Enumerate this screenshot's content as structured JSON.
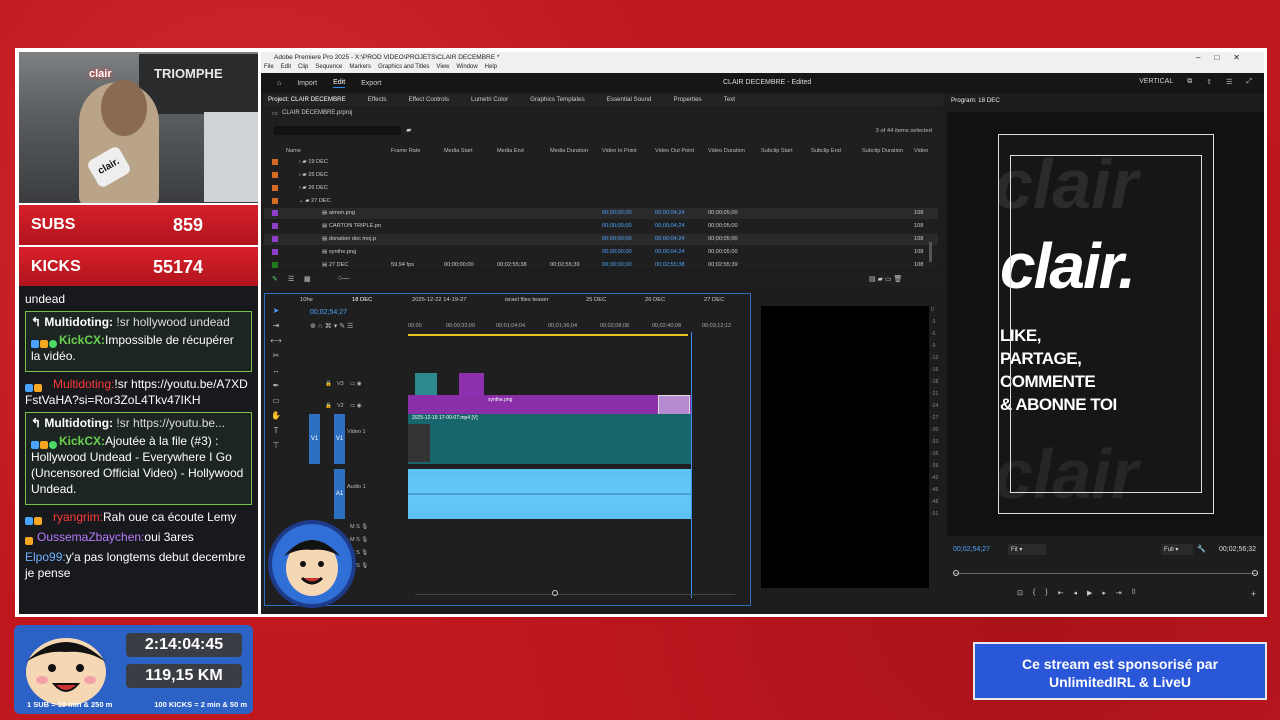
{
  "colors": {
    "brand_red": "#c11a22",
    "accent_blue": "#2d8ceb",
    "kick_green": "#6ad14f",
    "sponsor_blue": "#2a56d8"
  },
  "stats": {
    "subs_label": "SUBS",
    "subs_value": "859",
    "kicks_label": "KICKS",
    "kicks_value": "55174"
  },
  "webcam": {
    "neon_text": "clair",
    "poster_text": "TRIOMPHE",
    "mic_label": "clair."
  },
  "chat": {
    "top_text": "undead",
    "m1": {
      "user": "Multidoting:",
      "reply": "!sr hollywood undead",
      "user2": "KickCX:",
      "text": "Impossible de récupérer la vidéo."
    },
    "m2": {
      "user": "Multidoting:",
      "text": "!sr https://youtu.be/A7XDFstVaHA?si=Ror3ZoL4Tkv47IKH"
    },
    "m3": {
      "user": "Multidoting:",
      "reply": "!sr https://youtu.be...",
      "user2": "KickCX:",
      "text": "Ajoutée à la file (#3) : Hollywood Undead - Everywhere I Go (Uncensored Official Video) - Hollywood Undead."
    },
    "m4": {
      "user": "ryangrim:",
      "text": "Rah oue ca écoute Lemy"
    },
    "m5": {
      "user": "OussemaZbaychen:",
      "text": "oui 3ares"
    },
    "m6": {
      "user": "Elpo99:",
      "text": "y'a pas longtems debut decembre je pense"
    }
  },
  "premiere": {
    "app_title": "Adobe Premiere Pro 2025 - X:\\PROD VIDEO\\PROJETS\\CLAIR DECEMBRE *",
    "menu": [
      "File",
      "Edit",
      "Clip",
      "Sequence",
      "Markers",
      "Graphics and Titles",
      "View",
      "Window",
      "Help"
    ],
    "header_tabs": {
      "import": "Import",
      "edit": "Edit",
      "export": "Export"
    },
    "center_title": "CLAIR DECEMBRE - Edited",
    "vertical_label": "VERTICAL",
    "panels": [
      "Project: CLAIR DECEMBRE",
      "Effects",
      "Effect Controls",
      "Lumetri Color",
      "Graphics Templates",
      "Essential Sound",
      "Properties",
      "Text"
    ],
    "project": {
      "path": "CLAIR DECEMBRE.prproj",
      "count": "3 of 44 items selected",
      "columns": [
        "Name",
        "Frame Rate",
        "Media Start",
        "Media End",
        "Media Duration",
        "Video In Point",
        "Video Out Point",
        "Video Duration",
        "Subclip Start",
        "Subclip End",
        "Subclip Duration",
        "Video"
      ],
      "rows": [
        {
          "name": "19 DEC",
          "in": "",
          "out": "",
          "dur": "",
          "v": ""
        },
        {
          "name": "25 DEC",
          "in": "",
          "out": "",
          "dur": "",
          "v": ""
        },
        {
          "name": "26 DEC",
          "in": "",
          "out": "",
          "dur": "",
          "v": ""
        },
        {
          "name": "27 DEC",
          "in": "",
          "out": "",
          "dur": "",
          "v": ""
        },
        {
          "name": "aimon.png",
          "in": "00;00;00;00",
          "out": "00;00;04;24",
          "dur": "00;00;05;00",
          "v": "108"
        },
        {
          "name": "CARTON TRIPLE.pn",
          "in": "00;00;00;00",
          "out": "00;00;04;24",
          "dur": "00;00;05;00",
          "v": "108"
        },
        {
          "name": "donation dec moj.p",
          "in": "00;00;00;00",
          "out": "00;00;04;24",
          "dur": "00;00;05;00",
          "v": "108"
        },
        {
          "name": "synthe.png",
          "in": "00;00;00;00",
          "out": "00;00;04;24",
          "dur": "00;00;05;00",
          "v": "108"
        },
        {
          "name": "27 DEC",
          "in": "00;00;00;00",
          "out": "00;02;55;38",
          "dur": "00;02;55;39",
          "v": "108"
        }
      ],
      "row27": {
        "fps": "59,94 fps",
        "ms": "00;00;00;00",
        "me": "00;02;55;38",
        "md": "00;02;55;39"
      }
    },
    "timeline": {
      "tabs": [
        "10he",
        "18 DEC",
        "2025-12-22 14-19-27",
        "israel files teaser",
        "25 DEC",
        "26 DEC",
        "27 DEC"
      ],
      "timecode": "00;02;54;27",
      "ruler": [
        "00;00",
        "00;00;32;00",
        "00;01;04;04",
        "00;01;36;04",
        "00;02;08;08",
        "00;02;40;08",
        "00;03;12;12"
      ],
      "tracks": {
        "v3": "V3",
        "v2": "V2",
        "v1": "V1",
        "video1": "Video 1",
        "a1": "A1",
        "audio1": "Audio 1"
      },
      "clips": {
        "synthe": "synthe.png",
        "main": "2025-12-19 17-00-07.mp4 [V]"
      }
    },
    "program": {
      "label": "Program: 18 DEC",
      "logo": "clair.",
      "cta": [
        "LIKE,",
        "PARTAGE,",
        "COMMENTE",
        "& ABONNE TOI"
      ],
      "timecode": "00;02;54;27",
      "duration": "00;02;56;32",
      "fit": "Fit",
      "full": "Full"
    }
  },
  "overlay": {
    "timer": "2:14:04:45",
    "km": "119,15 KM",
    "rule1": "1 SUB = 10 min & 250 m",
    "rule2": "100 KICKS = 2 min & 50 m",
    "sponsor_line1": "Ce stream est sponsorisé par",
    "sponsor_line2": "UnlimitedIRL & LiveU"
  }
}
